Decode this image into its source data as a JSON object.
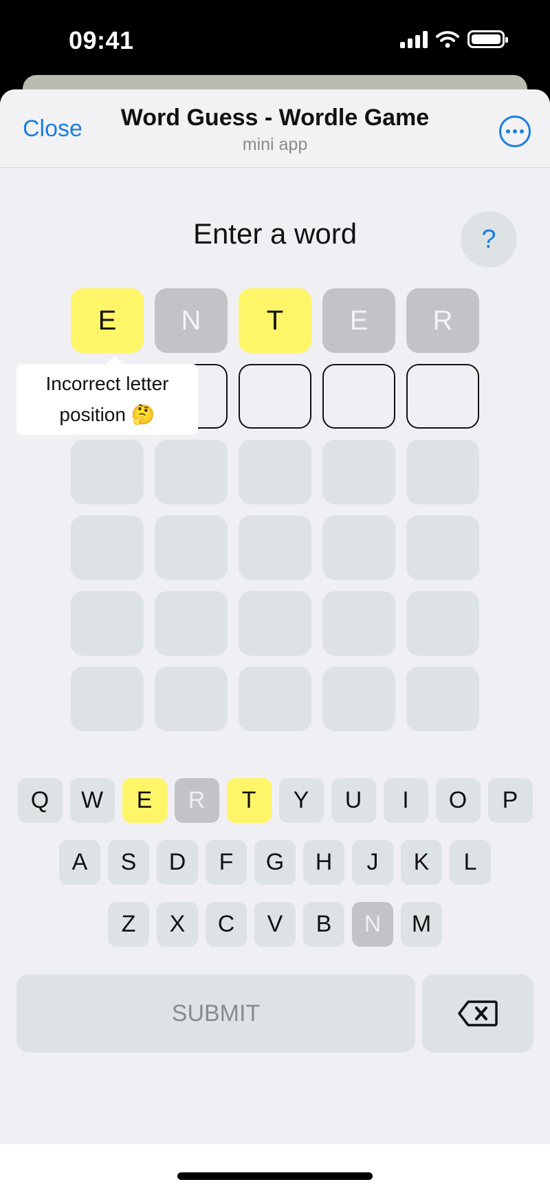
{
  "status": {
    "time": "09:41"
  },
  "header": {
    "close_label": "Close",
    "title": "Word Guess - Wordle Game",
    "subtitle": "mini app"
  },
  "game": {
    "prompt": "Enter a word",
    "help_label": "?",
    "tooltip": {
      "line1": "Incorrect letter",
      "line2": "position 🤔"
    },
    "board": [
      [
        {
          "letter": "E",
          "state": "present"
        },
        {
          "letter": "N",
          "state": "absent"
        },
        {
          "letter": "T",
          "state": "present"
        },
        {
          "letter": "E",
          "state": "absent"
        },
        {
          "letter": "R",
          "state": "absent"
        }
      ]
    ]
  },
  "keyboard": {
    "row1": [
      {
        "k": "Q",
        "s": ""
      },
      {
        "k": "W",
        "s": ""
      },
      {
        "k": "E",
        "s": "present"
      },
      {
        "k": "R",
        "s": "absent"
      },
      {
        "k": "T",
        "s": "present"
      },
      {
        "k": "Y",
        "s": ""
      },
      {
        "k": "U",
        "s": ""
      },
      {
        "k": "I",
        "s": ""
      },
      {
        "k": "O",
        "s": ""
      },
      {
        "k": "P",
        "s": ""
      }
    ],
    "row2": [
      {
        "k": "A",
        "s": ""
      },
      {
        "k": "S",
        "s": ""
      },
      {
        "k": "D",
        "s": ""
      },
      {
        "k": "F",
        "s": ""
      },
      {
        "k": "G",
        "s": ""
      },
      {
        "k": "H",
        "s": ""
      },
      {
        "k": "J",
        "s": ""
      },
      {
        "k": "K",
        "s": ""
      },
      {
        "k": "L",
        "s": ""
      }
    ],
    "row3": [
      {
        "k": "Z",
        "s": ""
      },
      {
        "k": "X",
        "s": ""
      },
      {
        "k": "C",
        "s": ""
      },
      {
        "k": "V",
        "s": ""
      },
      {
        "k": "B",
        "s": ""
      },
      {
        "k": "N",
        "s": "absent"
      },
      {
        "k": "M",
        "s": ""
      }
    ],
    "submit_label": "SUBMIT",
    "backspace_icon": "backspace-icon"
  },
  "colors": {
    "accent": "#1a7fe0",
    "present": "#fef568",
    "absent": "#c2c2c7",
    "empty": "#dde3e5"
  }
}
